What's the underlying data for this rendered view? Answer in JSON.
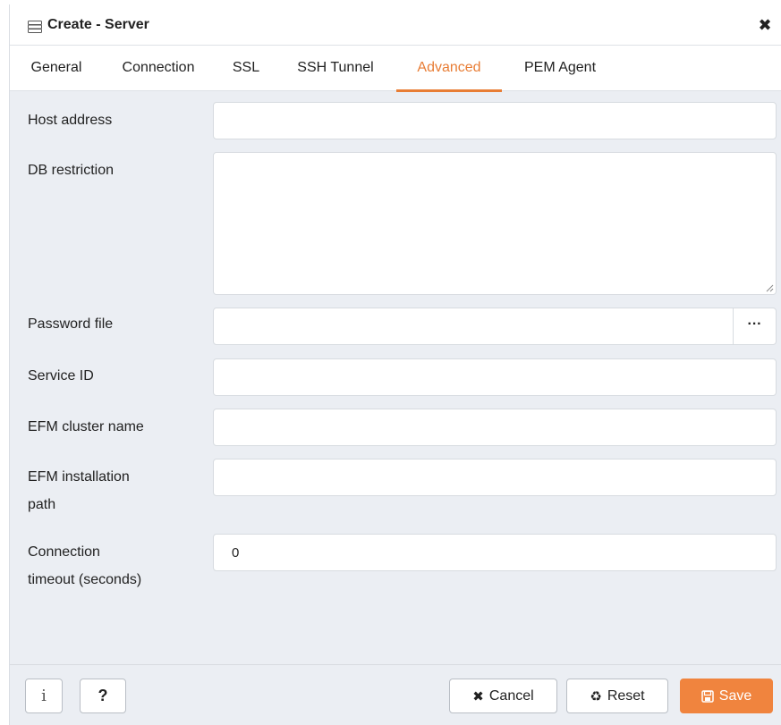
{
  "dialog": {
    "title": "Create - Server",
    "close_glyph": "✖",
    "icon": "server-icon"
  },
  "tabs": [
    {
      "label": "General",
      "active": false
    },
    {
      "label": "Connection",
      "active": false
    },
    {
      "label": "SSL",
      "active": false
    },
    {
      "label": "SSH Tunnel",
      "active": false
    },
    {
      "label": "Advanced",
      "active": true
    },
    {
      "label": "PEM Agent",
      "active": false
    }
  ],
  "form": {
    "host_address": {
      "label": "Host address",
      "value": ""
    },
    "db_restriction": {
      "label": "DB restriction",
      "value": ""
    },
    "password_file": {
      "label": "Password file",
      "value": "",
      "browse_label": "···"
    },
    "service_id": {
      "label": "Service ID",
      "value": ""
    },
    "efm_cluster_name": {
      "label": "EFM cluster name",
      "value": ""
    },
    "efm_installation_path": {
      "label_line1": "EFM installation",
      "label_line2": "path",
      "value": ""
    },
    "connection_timeout": {
      "label_line1": "Connection",
      "label_line2": "timeout (seconds)",
      "value": "0"
    }
  },
  "footer": {
    "info_glyph": "i",
    "help_glyph": "?",
    "cancel_glyph": "✖",
    "cancel_label": "Cancel",
    "reset_glyph": "♻",
    "reset_label": "Reset",
    "save_glyph": "🖫",
    "save_label": "Save"
  },
  "colors": {
    "accent": "#e87d35",
    "save_bg": "#f0843e",
    "panel_bg": "#ebeef3"
  }
}
